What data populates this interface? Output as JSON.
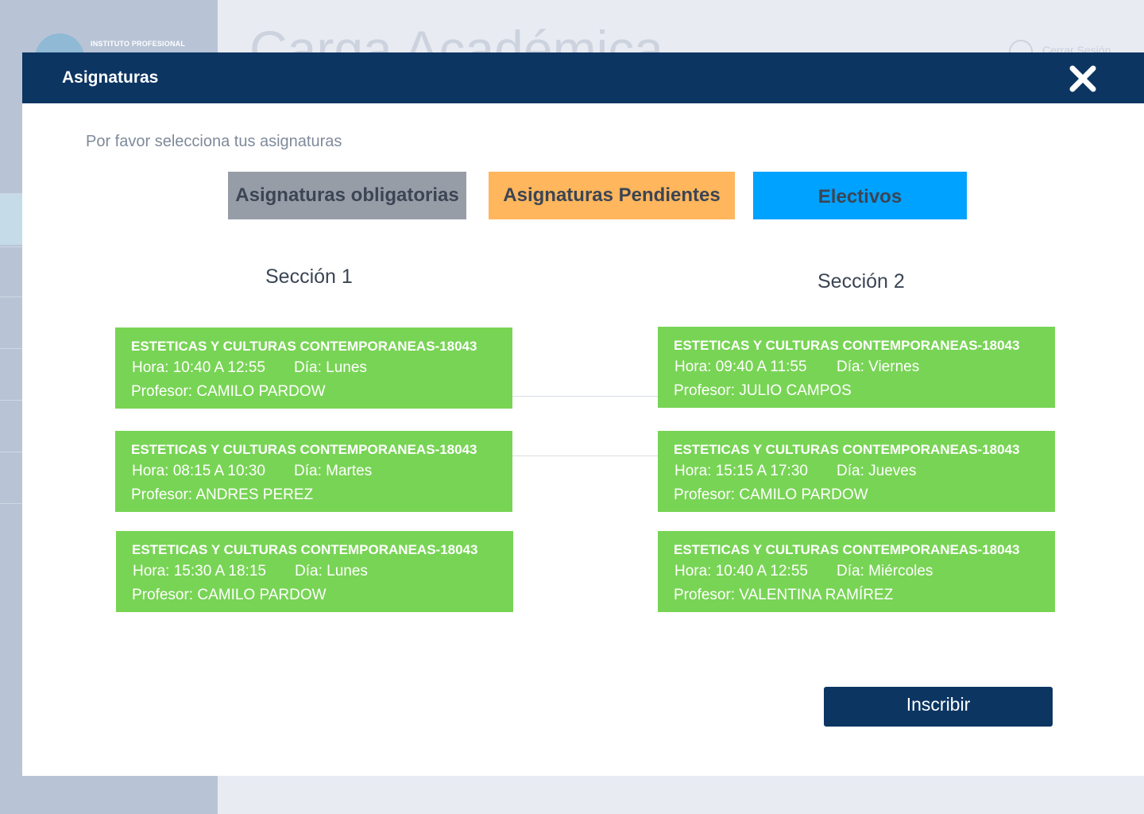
{
  "background": {
    "logo_text": "INSTITUTO PROFESIONAL",
    "page_title": "Carga Académica",
    "logout_label": "Cerrar Sesión"
  },
  "modal": {
    "title": "Asignaturas",
    "subtitle": "Por favor selecciona tus asignaturas",
    "tabs": [
      {
        "label": "Asignaturas obligatorias",
        "color": "#969da7"
      },
      {
        "label": "Asignaturas Pendientes",
        "color": "#ffb65c"
      },
      {
        "label": "Electivos",
        "color": "#00a2ff"
      }
    ],
    "sections": [
      {
        "title": "Sección 1",
        "courses": [
          {
            "name": "ESTETICAS Y CULTURAS  CONTEMPORANEAS-18043",
            "hora": "Hora: 10:40 A 12:55",
            "dia": "Día: Lunes",
            "profesor": "Profesor: CAMILO PARDOW"
          },
          {
            "name": "ESTETICAS Y CULTURAS  CONTEMPORANEAS-18043",
            "hora": "Hora: 08:15 A 10:30",
            "dia": "Día: Martes",
            "profesor": "Profesor:  ANDRES PEREZ"
          },
          {
            "name": "ESTETICAS Y CULTURAS  CONTEMPORANEAS-18043",
            "hora": "Hora: 15:30 A 18:15",
            "dia": "Día: Lunes",
            "profesor": "Profesor: CAMILO PARDOW"
          }
        ]
      },
      {
        "title": "Sección 2",
        "courses": [
          {
            "name": "ESTETICAS Y CULTURAS  CONTEMPORANEAS-18043",
            "hora": "Hora: 09:40 A 11:55",
            "dia": "Día: Viernes",
            "profesor": "Profesor: JULIO CAMPOS"
          },
          {
            "name": "ESTETICAS Y CULTURAS  CONTEMPORANEAS-18043",
            "hora": "Hora: 15:15 A 17:30",
            "dia": "Día: Jueves",
            "profesor": "Profesor: CAMILO PARDOW"
          },
          {
            "name": "ESTETICAS Y CULTURAS  CONTEMPORANEAS-18043",
            "hora": "Hora: 10:40 A 12:55",
            "dia": "Día: Miércoles",
            "profesor": "Profesor: VALENTINA RAMÍREZ"
          }
        ]
      }
    ],
    "submit_label": "Inscribir",
    "colors": {
      "header": "#0c3562",
      "card": "#78d455",
      "button": "#0c3562"
    },
    "close_icon": "close-icon"
  }
}
